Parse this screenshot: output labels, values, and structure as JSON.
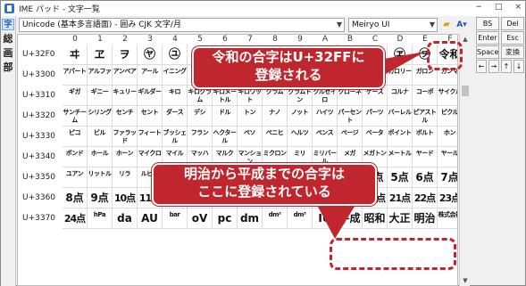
{
  "window": {
    "title": "IME パッド - 文字一覧",
    "buttons": [
      "−",
      "□",
      "×"
    ]
  },
  "left_toolbar": {
    "items": [
      {
        "label": "字",
        "active": true
      },
      {
        "label": "総",
        "active": false
      },
      {
        "label": "画",
        "active": false
      },
      {
        "label": "部",
        "active": false
      }
    ]
  },
  "toolbar": {
    "range_select": "Unicode (基本多言語面) - 囲み CJK 文字/月",
    "font_select": "Meiryo UI"
  },
  "grid": {
    "columns": [
      "0",
      "1",
      "2",
      "3",
      "4",
      "5",
      "6",
      "7",
      "8",
      "9",
      "A",
      "B",
      "C",
      "D",
      "E",
      "F"
    ],
    "rows": [
      {
        "code": "U+32F0",
        "cells": [
          "ヰ",
          "ヱ",
          "ヲ",
          "㋳",
          "㋴",
          "㋵",
          "㋶",
          "㋷",
          "㋸",
          "㋹",
          "㋺",
          "㋻",
          "㋼",
          "㋽",
          "㋾",
          "令和"
        ]
      },
      {
        "code": "U+3300",
        "cells": [
          "アパート",
          "アルファ",
          "アンペア",
          "アール",
          "イニング",
          "インチ",
          "ウォン",
          "エスクード",
          "エーカー",
          "オンス",
          "オーム",
          "カイリ",
          "カラット",
          "カロリー",
          "ガロン",
          "ガンマ"
        ]
      },
      {
        "code": "U+3310",
        "cells": [
          "ギガ",
          "ギニー",
          "キュリー",
          "ギルダー",
          "キロ",
          "キログラム",
          "キロメートル",
          "キロワット",
          "グラム",
          "グラムトン",
          "クルゼイロ",
          "クローネ",
          "ケース",
          "コルナ",
          "コーポ",
          "サイクル"
        ]
      },
      {
        "code": "U+3320",
        "cells": [
          "サンチーム",
          "シリング",
          "センチ",
          "セント",
          "ダース",
          "デシ",
          "ドル",
          "トン",
          "ナノ",
          "ノット",
          "ハイツ",
          "パーセント",
          "パーツ",
          "バーレル",
          "ピアストル",
          "ピクル"
        ]
      },
      {
        "code": "U+3330",
        "cells": [
          "ピコ",
          "ビル",
          "ファラッド",
          "フィート",
          "ブッシェル",
          "フラン",
          "ヘクタール",
          "ペソ",
          "ペニヒ",
          "ヘルツ",
          "ペンス",
          "ページ",
          "ベータ",
          "ポイント",
          "ボルト",
          "ホン"
        ]
      },
      {
        "code": "U+3340",
        "cells": [
          "ポンド",
          "ホール",
          "ホーン",
          "マイクロ",
          "マイル",
          "マッハ",
          "マルク",
          "マンション",
          "ミクロン",
          "ミリ",
          "ミリバール",
          "メガ",
          "メガトン",
          "メートル",
          "ヤード",
          "ヤール"
        ]
      },
      {
        "code": "U+3350",
        "cells": [
          "ユアン",
          "リットル",
          "リラ",
          "ルピー",
          "ルーブル",
          "レム",
          "レントゲン",
          "ワット",
          "0点",
          "1点",
          "2点",
          "3点",
          "4点",
          "5点",
          "6点",
          "7点"
        ]
      },
      {
        "code": "U+3360",
        "cells": [
          "8点",
          "9点",
          "10点",
          "11点",
          "12点",
          "13点",
          "14点",
          "15点",
          "16点",
          "17点",
          "18点",
          "19点",
          "20点",
          "21点",
          "22点",
          "23点"
        ]
      },
      {
        "code": "U+3370",
        "cells": [
          "24点",
          "hPa",
          "da",
          "AU",
          "bar",
          "oV",
          "pc",
          "dm",
          "dm²",
          "dm³",
          "IU",
          "平成",
          "昭和",
          "大正",
          "明治",
          "株式会社"
        ]
      }
    ]
  },
  "keypad": {
    "keys": [
      "BS",
      "Del",
      "Enter",
      "Esc",
      "Space",
      "変換",
      "←",
      "→",
      "↑",
      "↓"
    ]
  },
  "callouts": {
    "reiwa": "令和の合字はU+32FFに\n登録される",
    "eras": "明治から平成までの合字は\nここに登録されている"
  },
  "colors": {
    "accent_red": "#c0262d",
    "active_blue": "#cfe3fb"
  },
  "icons": {
    "app": "ime-pad-icon",
    "folder": "folder-icon",
    "font": "font-size-icon"
  }
}
